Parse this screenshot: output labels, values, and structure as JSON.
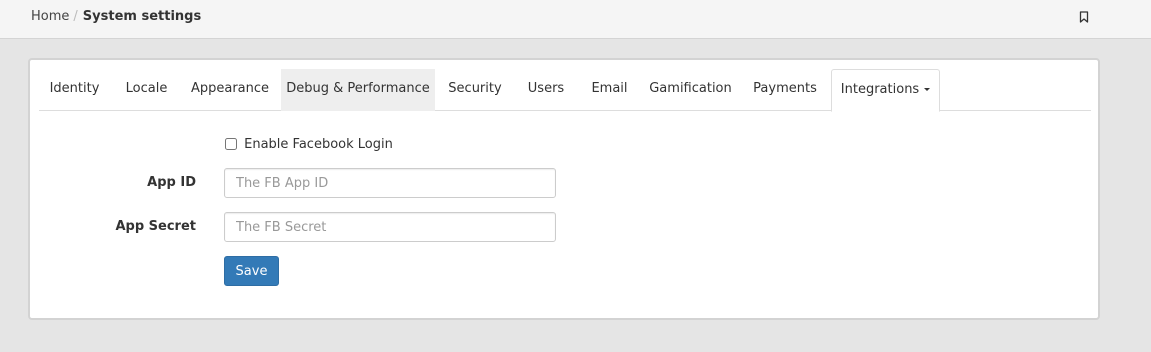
{
  "breadcrumb": {
    "home": "Home",
    "separator": "/",
    "current": "System settings"
  },
  "header": {
    "bookmark_icon": "bookmark-icon"
  },
  "tabs": [
    {
      "label": "Identity"
    },
    {
      "label": "Locale"
    },
    {
      "label": "Appearance"
    },
    {
      "label": "Debug & Performance"
    },
    {
      "label": "Security"
    },
    {
      "label": "Users"
    },
    {
      "label": "Email"
    },
    {
      "label": "Gamification"
    },
    {
      "label": "Payments"
    },
    {
      "label": "Integrations",
      "dropdown": true,
      "active": true
    }
  ],
  "form": {
    "enable_facebook_label": "Enable Facebook Login",
    "enable_facebook_checked": false,
    "app_id_label": "App ID",
    "app_id_value": "",
    "app_id_placeholder": "The FB App ID",
    "app_secret_label": "App Secret",
    "app_secret_value": "",
    "app_secret_placeholder": "The FB Secret",
    "save_label": "Save"
  },
  "colors": {
    "primary_button": "#337ab7",
    "page_background": "#e5e5e5",
    "hover_tab_background": "#eeeeee"
  }
}
